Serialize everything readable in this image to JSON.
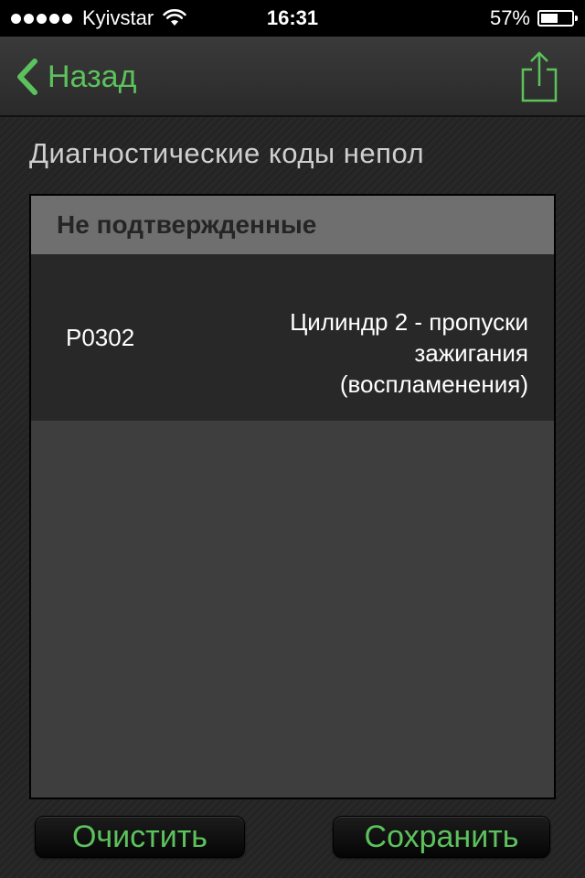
{
  "status_bar": {
    "carrier": "Kyivstar",
    "time": "16:31",
    "battery_percent": "57%",
    "battery_level": 0.57,
    "signal_dots": 5
  },
  "nav": {
    "back_label": "Назад",
    "back_icon": "chevron-left-icon",
    "share_icon": "share-icon"
  },
  "content": {
    "section_title": "Диагностические коды непол",
    "group_header": "Не подтвержденные",
    "codes": [
      {
        "code": "P0302",
        "description": "Цилиндр 2 - пропуски зажигания (воспламенения)"
      }
    ]
  },
  "buttons": {
    "clear_label": "Очистить",
    "save_label": "Сохранить"
  },
  "colors": {
    "accent": "#5cc25c",
    "group_header_bg": "#6f6f6f",
    "row_bg": "#282828"
  }
}
